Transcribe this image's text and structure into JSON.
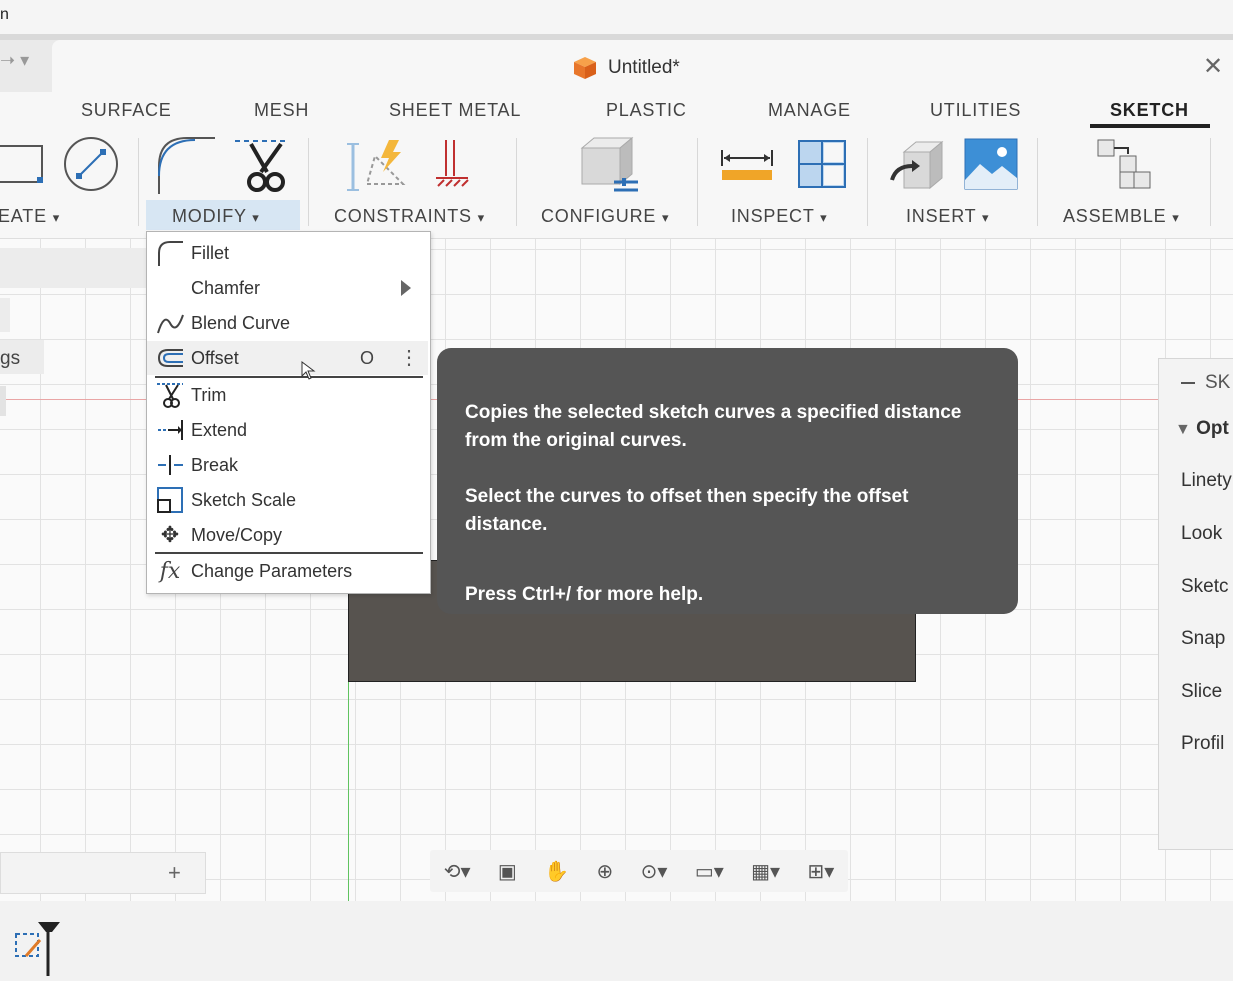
{
  "window": {
    "title": "Untitled*",
    "top_char": "n"
  },
  "tabs": [
    {
      "label": "SURFACE"
    },
    {
      "label": "MESH"
    },
    {
      "label": "SHEET METAL"
    },
    {
      "label": "PLASTIC"
    },
    {
      "label": "MANAGE"
    },
    {
      "label": "UTILITIES"
    },
    {
      "label": "SKETCH",
      "active": true
    }
  ],
  "groups": [
    {
      "label": "EATE",
      "dropdown": "▾"
    },
    {
      "label": "MODIFY",
      "dropdown": "▾",
      "open": true
    },
    {
      "label": "CONSTRAINTS",
      "dropdown": "▾"
    },
    {
      "label": "CONFIGURE",
      "dropdown": "▾"
    },
    {
      "label": "INSPECT",
      "dropdown": "▾"
    },
    {
      "label": "INSERT",
      "dropdown": "▾"
    },
    {
      "label": "ASSEMBLE",
      "dropdown": "▾"
    }
  ],
  "modify_menu": {
    "items": [
      {
        "label": "Fillet",
        "icon": "fillet-icon"
      },
      {
        "label": "Chamfer",
        "submenu": true
      },
      {
        "label": "Blend Curve",
        "icon": "blend-curve-icon"
      },
      {
        "label": "Offset",
        "icon": "offset-icon",
        "shortcut": "O",
        "hovered": true
      },
      {
        "label": "Trim",
        "icon": "trim-icon"
      },
      {
        "label": "Extend",
        "icon": "extend-icon"
      },
      {
        "label": "Break",
        "icon": "break-icon"
      },
      {
        "label": "Sketch Scale",
        "icon": "sketch-scale-icon"
      },
      {
        "label": "Move/Copy",
        "icon": "move-icon"
      },
      {
        "label": "Change Parameters",
        "icon": "fx-icon"
      }
    ]
  },
  "tooltip": {
    "line1": "Copies the selected sketch curves a specified distance from the original curves.",
    "line2": "Select the curves to offset then specify the offset distance.",
    "line3": "Press Ctrl+/ for more help."
  },
  "left_panel": {
    "partial_text": "gs",
    "add_label": "+"
  },
  "right_panel": {
    "header": "SK",
    "section": "Opt",
    "rows": [
      "Linety",
      "Look",
      "Sketc",
      "Snap",
      "Slice",
      "Profil"
    ]
  },
  "colors": {
    "accent_tab_underline": "#222222",
    "tooltip_bg": "#555555",
    "hover_bg": "#d7e6f3"
  }
}
